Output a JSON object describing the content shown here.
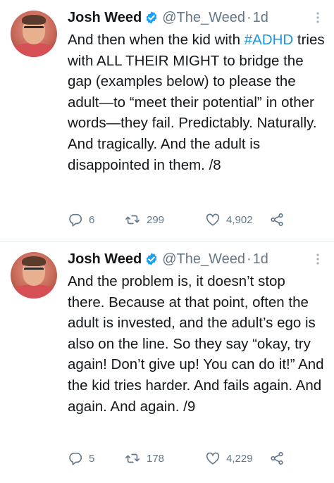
{
  "tweets": [
    {
      "author": {
        "name": "Josh Weed",
        "handle": "@The_Weed",
        "verified": true
      },
      "separator": "·",
      "time": "1d",
      "text": {
        "before": "And then when the kid with ",
        "hashtag": "#ADHD",
        "after": " tries with ALL THEIR MIGHT to bridge the gap (examples below) to please the adult—to “meet their potential” in other words—they fail. Predictably. Naturally. And tragically. And the adult is disappointed in them. /8"
      },
      "counts": {
        "replies": "6",
        "retweets": "299",
        "likes": "4,902"
      }
    },
    {
      "author": {
        "name": "Josh Weed",
        "handle": "@The_Weed",
        "verified": true
      },
      "separator": "·",
      "time": "1d",
      "text": {
        "before": "And the problem is, it doesn’t stop there. Because at that point, often the adult is invested, and the adult’s ego is also on the line. So they say “okay, try again! Don’t give up! You can do it!” And the kid tries harder. And fails again. And again. And again. /9",
        "hashtag": "",
        "after": ""
      },
      "counts": {
        "replies": "5",
        "retweets": "178",
        "likes": "4,229"
      }
    }
  ],
  "icons": {
    "verified": "verified-badge-icon",
    "more": "more-options-icon",
    "reply": "reply-icon",
    "retweet": "retweet-icon",
    "like": "heart-icon",
    "share": "share-icon"
  },
  "colors": {
    "text": "#14171a",
    "secondary": "#657786",
    "link": "#1b95e0",
    "verified": "#1da1f2"
  }
}
